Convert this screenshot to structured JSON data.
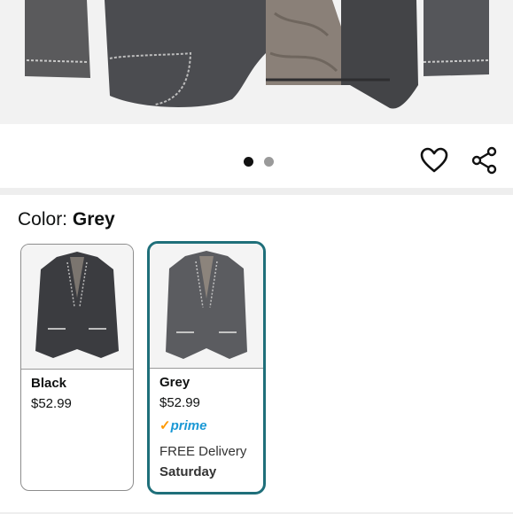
{
  "carousel": {
    "total_images": 2,
    "active_index": 1
  },
  "colors": {
    "accent": "#1f6f7a",
    "prime_blue": "#1a98d5",
    "prime_orange": "#ff9900",
    "dot_active": "#111111",
    "dot_inactive": "#9a9a9a"
  },
  "color_selector": {
    "label": "Color: ",
    "selected": "Grey"
  },
  "swatches": [
    {
      "name": "Black",
      "price": "$52.99",
      "selected": false
    },
    {
      "name": "Grey",
      "price": "$52.99",
      "selected": true,
      "prime": "prime",
      "delivery_label": "FREE Delivery",
      "delivery_day": "Saturday"
    }
  ],
  "icons": {
    "wishlist": "heart-outline-icon",
    "share": "share-icon"
  }
}
